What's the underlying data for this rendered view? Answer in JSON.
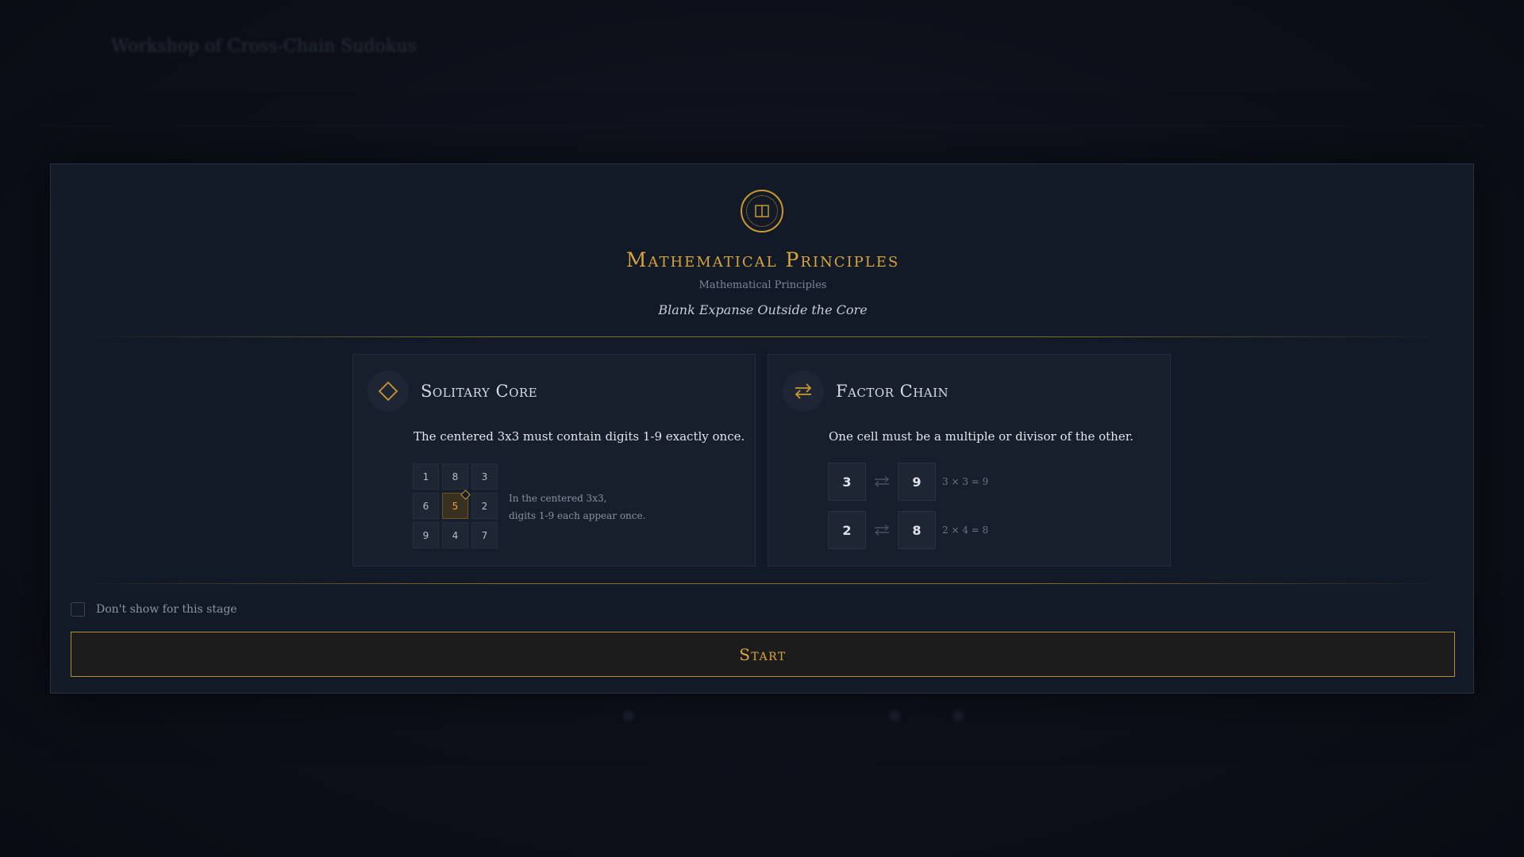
{
  "background": {
    "title": "Workshop of Cross-Chain Sudokus"
  },
  "modal": {
    "title": "Mathematical Principles",
    "subtitle": "Mathematical Principles",
    "stage_name": "Blank Expanse Outside the Core",
    "emblem_icon": "book-icon",
    "accent_color": "#d6a43a"
  },
  "rules": [
    {
      "icon": "diamond-icon",
      "title": "Solitary Core",
      "description": "The centered 3x3 must contain digits 1-9 exactly once.",
      "grid": [
        "1",
        "8",
        "3",
        "6",
        "5",
        "2",
        "9",
        "4",
        "7"
      ],
      "highlighted_cell": "5",
      "note_line1": "In the centered 3x3,",
      "note_line2": "digits 1-9 each appear once."
    },
    {
      "icon": "swap-arrows-icon",
      "title": "Factor Chain",
      "description": "One cell must be a multiple or divisor of the other.",
      "examples": [
        {
          "a": "3",
          "b": "9",
          "equation": "3 × 3 = 9"
        },
        {
          "a": "2",
          "b": "8",
          "equation": "2 × 4 = 8"
        }
      ]
    }
  ],
  "footer": {
    "checkbox_label": "Don't show for this stage",
    "checkbox_checked": false,
    "start_label": "Start"
  }
}
